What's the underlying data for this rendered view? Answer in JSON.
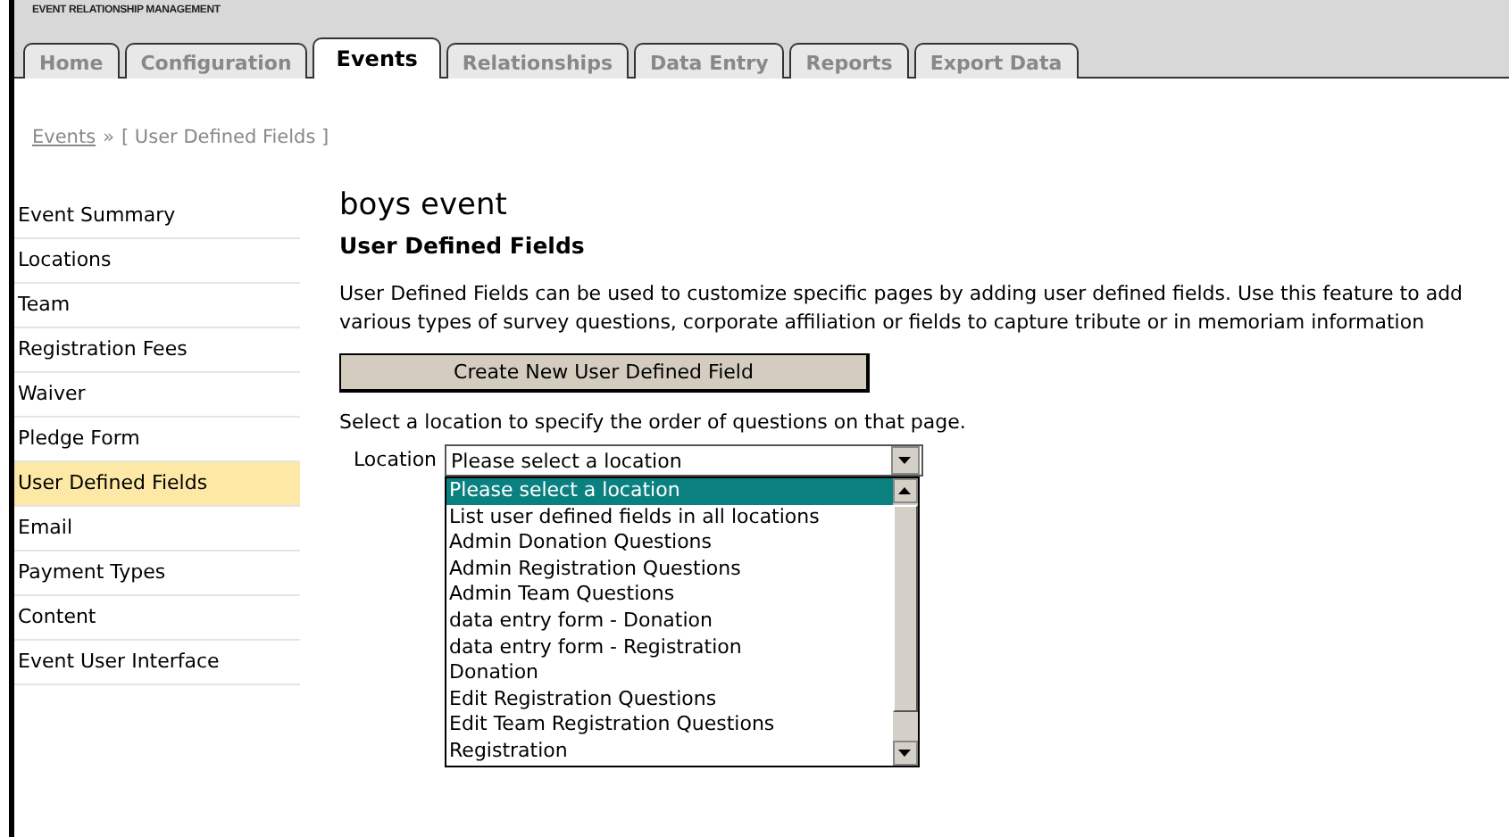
{
  "app_title": "EVENT RELATIONSHIP MANAGEMENT",
  "tabs": [
    {
      "label": "Home",
      "selected": false
    },
    {
      "label": "Configuration",
      "selected": false
    },
    {
      "label": "Events",
      "selected": true
    },
    {
      "label": "Relationships",
      "selected": false
    },
    {
      "label": "Data Entry",
      "selected": false
    },
    {
      "label": "Reports",
      "selected": false
    },
    {
      "label": "Export Data",
      "selected": false
    }
  ],
  "breadcrumb": {
    "link": "Events",
    "separator": "»",
    "current": "[ User Defined Fields ]"
  },
  "sidebar": {
    "items": [
      {
        "label": "Event Summary",
        "selected": false
      },
      {
        "label": "Locations",
        "selected": false
      },
      {
        "label": "Team",
        "selected": false
      },
      {
        "label": "Registration Fees",
        "selected": false
      },
      {
        "label": "Waiver",
        "selected": false
      },
      {
        "label": "Pledge Form",
        "selected": false
      },
      {
        "label": "User Defined Fields",
        "selected": true
      },
      {
        "label": "Email",
        "selected": false
      },
      {
        "label": "Payment Types",
        "selected": false
      },
      {
        "label": "Content",
        "selected": false
      },
      {
        "label": "Event User Interface",
        "selected": false
      }
    ]
  },
  "main": {
    "event_name": "boys event",
    "heading": "User Defined Fields",
    "description": "User Defined Fields can be used to customize specific pages by adding user defined fields. Use this feature to add various types of survey questions, corporate affiliation or fields to capture tribute or in memoriam information",
    "create_button": "Create New User Defined Field",
    "instruction": "Select a location to specify the order of questions on that page.",
    "location": {
      "label": "Location",
      "value": "Please select a location",
      "expanded": true,
      "options": [
        {
          "label": "Please select a location",
          "selected": true
        },
        {
          "label": "List user defined fields in all locations",
          "selected": false
        },
        {
          "label": "Admin Donation Questions",
          "selected": false
        },
        {
          "label": "Admin Registration Questions",
          "selected": false
        },
        {
          "label": "Admin Team Questions",
          "selected": false
        },
        {
          "label": "data entry form - Donation",
          "selected": false
        },
        {
          "label": "data entry form - Registration",
          "selected": false
        },
        {
          "label": "Donation",
          "selected": false
        },
        {
          "label": "Edit Registration Questions",
          "selected": false
        },
        {
          "label": "Edit Team Registration Questions",
          "selected": false
        },
        {
          "label": "Registration",
          "selected": false
        }
      ]
    }
  }
}
